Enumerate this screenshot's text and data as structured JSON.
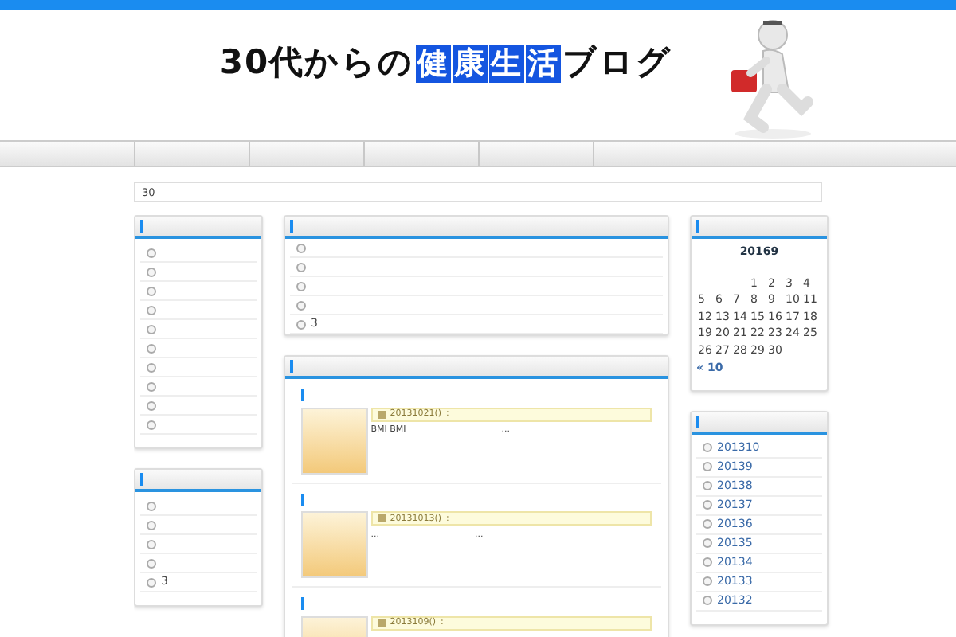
{
  "header": {
    "logo": [
      {
        "text": "30代からの",
        "boxed": false
      },
      {
        "text": "健",
        "boxed": true
      },
      {
        "text": "康",
        "boxed": true
      },
      {
        "text": "生",
        "boxed": true
      },
      {
        "text": "活",
        "boxed": true
      },
      {
        "text": "ブログ",
        "boxed": false
      }
    ]
  },
  "breadcrumb": "30",
  "left_widgets": [
    {
      "items": [
        {
          "kind": "bullet"
        },
        {
          "kind": "bullet"
        },
        {
          "kind": "bullet"
        },
        {
          "kind": "bullet"
        },
        {
          "kind": "bullet"
        },
        {
          "kind": "bullet"
        },
        {
          "kind": "bullet"
        },
        {
          "kind": "bullet"
        },
        {
          "kind": "bullet"
        },
        {
          "kind": "bullet"
        }
      ]
    },
    {
      "items": [
        {
          "kind": "bullet"
        },
        {
          "kind": "bullet"
        },
        {
          "kind": "bullet"
        },
        {
          "kind": "bullet"
        },
        {
          "kind": "link",
          "label": "3"
        }
      ]
    }
  ],
  "center_widget": {
    "items": [
      {
        "kind": "bullet"
      },
      {
        "kind": "bullet"
      },
      {
        "kind": "bullet"
      },
      {
        "kind": "bullet"
      },
      {
        "kind": "link",
        "label": "3"
      }
    ]
  },
  "posts": [
    {
      "date": "20131021()",
      "meta": ":",
      "excerpt": [
        "BMI BMI",
        "..."
      ]
    },
    {
      "date": "20131013()",
      "meta": ":",
      "excerpt": [
        "...",
        "..."
      ]
    },
    {
      "date": "2013109()",
      "meta": ":"
    }
  ],
  "calendar": {
    "title": "20169",
    "weeks": [
      {
        "kind": "lead",
        "days": [
          "1",
          "2",
          "3",
          "4"
        ]
      },
      {
        "days": [
          "5",
          "6",
          "7",
          "8",
          "9",
          "10",
          "11"
        ]
      },
      {
        "days": [
          "12",
          "13",
          "14",
          "15",
          "16",
          "17",
          "18"
        ]
      },
      {
        "days": [
          "19",
          "20",
          "21",
          "22",
          "23",
          "24",
          "25"
        ]
      },
      {
        "kind": "tail",
        "days": [
          "26",
          "27",
          "28",
          "29",
          "30"
        ]
      }
    ],
    "prev": "« 10"
  },
  "archives": [
    "201310",
    "20139",
    "20138",
    "20137",
    "20136",
    "20135",
    "20134",
    "20133",
    "20132"
  ]
}
